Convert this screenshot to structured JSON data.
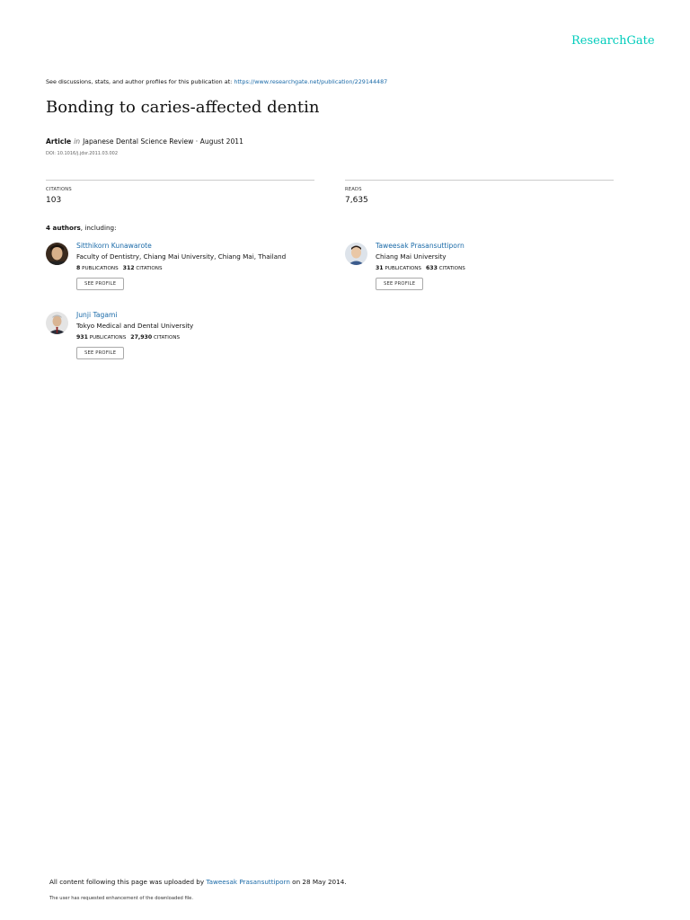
{
  "header": {
    "brand": "ResearchGate",
    "discussion_prefix": "See discussions, stats, and author profiles for this publication at: ",
    "publication_url": "https://www.researchgate.net/publication/229144487"
  },
  "article": {
    "title": "Bonding to caries-affected dentin",
    "type": "Article",
    "in_word": "in",
    "journal": "Japanese Dental Science Review · August 2011",
    "doi": "DOI: 10.1016/j.jdsr.2011.03.002"
  },
  "stats": {
    "citations_label": "CITATIONS",
    "citations_value": "103",
    "reads_label": "READS",
    "reads_value": "7,635"
  },
  "authors_heading": {
    "count": "4 authors",
    "suffix": ", including:"
  },
  "authors": [
    {
      "name": "Sitthikorn Kunawarote",
      "institution": "Faculty of Dentistry, Chiang Mai University, Chiang Mai, Thailand",
      "publications": "8",
      "publications_label": "PUBLICATIONS",
      "citations": "312",
      "citations_label": "CITATIONS",
      "button": "SEE PROFILE"
    },
    {
      "name": "Taweesak Prasansuttiporn",
      "institution": "Chiang Mai University",
      "publications": "31",
      "publications_label": "PUBLICATIONS",
      "citations": "633",
      "citations_label": "CITATIONS",
      "button": "SEE PROFILE"
    },
    {
      "name": "Junji Tagami",
      "institution": "Tokyo Medical and Dental University",
      "publications": "931",
      "publications_label": "PUBLICATIONS",
      "citations": "27,930",
      "citations_label": "CITATIONS",
      "button": "SEE PROFILE"
    }
  ],
  "footer": {
    "upload_prefix": "All content following this page was uploaded by ",
    "uploader": "Taweesak Prasansuttiporn",
    "upload_suffix": " on 28 May 2014.",
    "enhancement_note": "The user has requested enhancement of the downloaded file."
  },
  "colors": {
    "brand": "#00ccbb",
    "link": "#1a6aa8"
  }
}
